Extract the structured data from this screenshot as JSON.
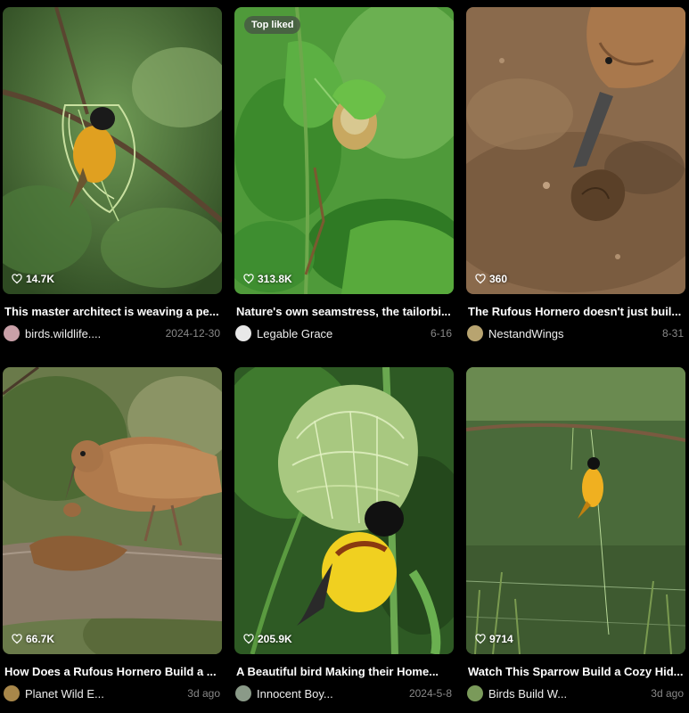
{
  "feed": {
    "cards": [
      {
        "title": "This master architect is weaving a pe...",
        "likes": "14.7K",
        "author": "birds.wildlife....",
        "date": "2024-12-30",
        "badge": "",
        "avatar_color": "#c9a0a8"
      },
      {
        "title": "Nature's own seamstress, the tailorbi...",
        "likes": "313.8K",
        "author": "Legable Grace",
        "date": "6-16",
        "badge": "Top liked",
        "avatar_color": "#e8e8e8"
      },
      {
        "title": "The Rufous Hornero doesn't just buil...",
        "likes": "360",
        "author": "NestandWings",
        "date": "8-31",
        "badge": "",
        "avatar_color": "#b8a470"
      },
      {
        "title": "How Does a Rufous Hornero Build a ...",
        "likes": "66.7K",
        "author": "Planet Wild E...",
        "date": "3d ago",
        "badge": "",
        "avatar_color": "#a8874a"
      },
      {
        "title": "A Beautiful bird Making their Home...",
        "likes": "205.9K",
        "author": "Innocent Boy...",
        "date": "2024-5-8",
        "badge": "",
        "avatar_color": "#8a9a88"
      },
      {
        "title": "Watch This Sparrow Build a Cozy Hid...",
        "likes": "9714",
        "author": "Birds Build W...",
        "date": "3d ago",
        "badge": "",
        "avatar_color": "#7a9a5a"
      }
    ]
  }
}
